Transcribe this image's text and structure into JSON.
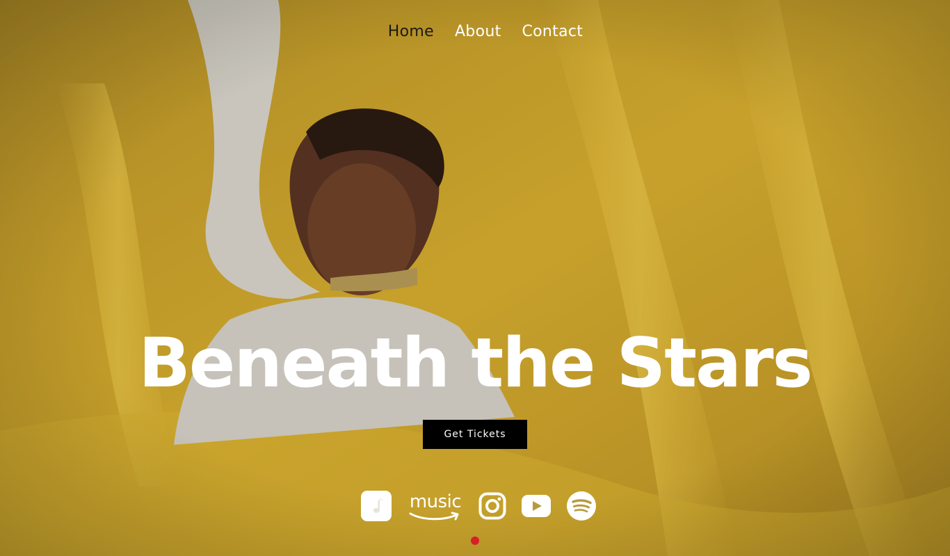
{
  "nav": {
    "items": [
      {
        "label": "Home",
        "active": true
      },
      {
        "label": "About",
        "active": false
      },
      {
        "label": "Contact",
        "active": false
      }
    ]
  },
  "hero": {
    "title": "Beneath the Stars",
    "cta_label": "Get Tickets"
  },
  "socials": [
    {
      "icon": "apple-music-icon"
    },
    {
      "icon": "amazon-music-icon",
      "text": "music"
    },
    {
      "icon": "instagram-icon"
    },
    {
      "icon": "youtube-icon"
    },
    {
      "icon": "spotify-icon"
    }
  ],
  "carousel": {
    "slides": 1,
    "active_index": 0
  },
  "colors": {
    "background": "#c9a42a",
    "nav_active": "#1c1a14",
    "cta_background": "#000000",
    "indicator": "#d81f28"
  }
}
